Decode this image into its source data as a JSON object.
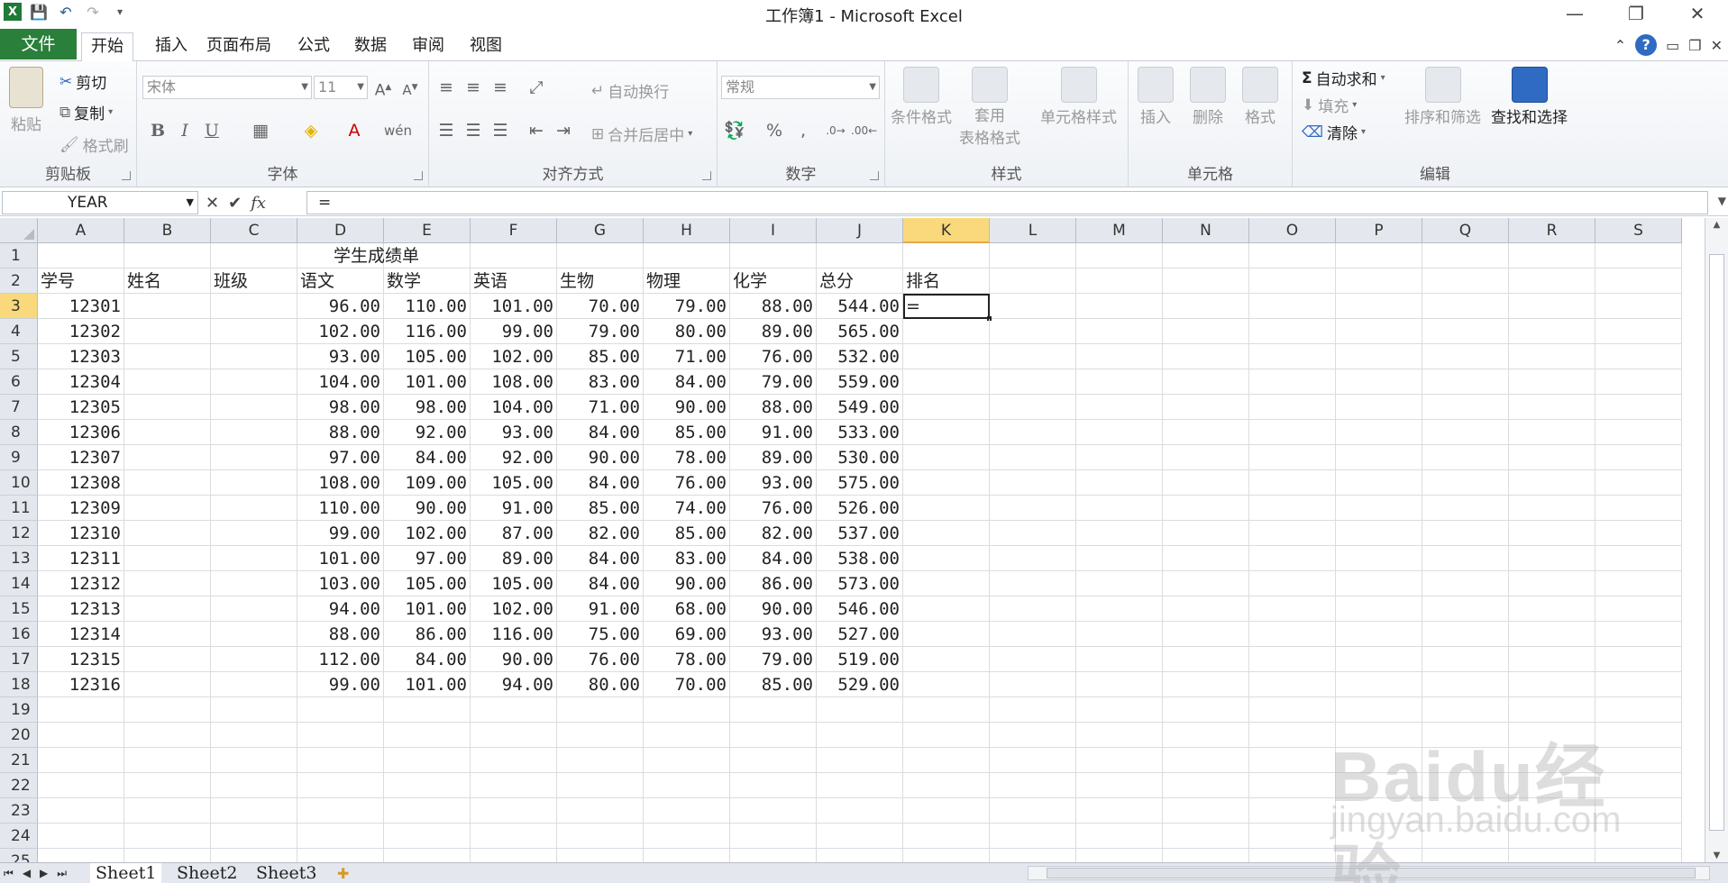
{
  "window": {
    "title": "工作簿1 - Microsoft Excel",
    "controls": [
      "—",
      "❐",
      "✕"
    ]
  },
  "tabs": {
    "file": "文件",
    "items": [
      "开始",
      "插入",
      "页面布局",
      "公式",
      "数据",
      "审阅",
      "视图"
    ]
  },
  "ribbon": {
    "clipboard": {
      "label": "剪贴板",
      "paste": "粘贴",
      "cut": "剪切",
      "copy": "复制",
      "format_painter": "格式刷"
    },
    "font": {
      "label": "字体",
      "font_name": "宋体",
      "font_size": "11",
      "bold": "B",
      "italic": "I",
      "underline": "U"
    },
    "alignment": {
      "label": "对齐方式",
      "wrap": "自动换行",
      "merge": "合并后居中"
    },
    "number": {
      "label": "数字",
      "format": "常规",
      "percent": "%",
      "comma": ","
    },
    "styles": {
      "label": "样式",
      "conditional": "条件格式",
      "table_line1": "套用",
      "table_line2": "表格格式",
      "cell_styles": "单元格样式"
    },
    "cells": {
      "label": "单元格",
      "insert": "插入",
      "delete": "删除",
      "format": "格式"
    },
    "editing": {
      "label": "编辑",
      "autosum": "自动求和",
      "fill": "填充",
      "clear": "清除",
      "sort": "排序和筛选",
      "find": "查找和选择"
    }
  },
  "formula_bar": {
    "name_box": "YEAR",
    "formula": "="
  },
  "grid": {
    "columns": [
      "A",
      "B",
      "C",
      "D",
      "E",
      "F",
      "G",
      "H",
      "I",
      "J",
      "K",
      "L",
      "M",
      "N",
      "O",
      "P",
      "Q",
      "R",
      "S"
    ],
    "selected_column": "K",
    "selected_row": 3,
    "title": "学生成绩单",
    "headers": [
      "学号",
      "姓名",
      "班级",
      "语文",
      "数学",
      "英语",
      "生物",
      "物理",
      "化学",
      "总分",
      "排名"
    ],
    "active_cell_text": "=",
    "rows": [
      [
        "12301",
        "96.00",
        "110.00",
        "101.00",
        "70.00",
        "79.00",
        "88.00",
        "544.00"
      ],
      [
        "12302",
        "102.00",
        "116.00",
        "99.00",
        "79.00",
        "80.00",
        "89.00",
        "565.00"
      ],
      [
        "12303",
        "93.00",
        "105.00",
        "102.00",
        "85.00",
        "71.00",
        "76.00",
        "532.00"
      ],
      [
        "12304",
        "104.00",
        "101.00",
        "108.00",
        "83.00",
        "84.00",
        "79.00",
        "559.00"
      ],
      [
        "12305",
        "98.00",
        "98.00",
        "104.00",
        "71.00",
        "90.00",
        "88.00",
        "549.00"
      ],
      [
        "12306",
        "88.00",
        "92.00",
        "93.00",
        "84.00",
        "85.00",
        "91.00",
        "533.00"
      ],
      [
        "12307",
        "97.00",
        "84.00",
        "92.00",
        "90.00",
        "78.00",
        "89.00",
        "530.00"
      ],
      [
        "12308",
        "108.00",
        "109.00",
        "105.00",
        "84.00",
        "76.00",
        "93.00",
        "575.00"
      ],
      [
        "12309",
        "110.00",
        "90.00",
        "91.00",
        "85.00",
        "74.00",
        "76.00",
        "526.00"
      ],
      [
        "12310",
        "99.00",
        "102.00",
        "87.00",
        "82.00",
        "85.00",
        "82.00",
        "537.00"
      ],
      [
        "12311",
        "101.00",
        "97.00",
        "89.00",
        "84.00",
        "83.00",
        "84.00",
        "538.00"
      ],
      [
        "12312",
        "103.00",
        "105.00",
        "105.00",
        "84.00",
        "90.00",
        "86.00",
        "573.00"
      ],
      [
        "12313",
        "94.00",
        "101.00",
        "102.00",
        "91.00",
        "68.00",
        "90.00",
        "546.00"
      ],
      [
        "12314",
        "88.00",
        "86.00",
        "116.00",
        "75.00",
        "69.00",
        "93.00",
        "527.00"
      ],
      [
        "12315",
        "112.00",
        "84.00",
        "90.00",
        "76.00",
        "78.00",
        "79.00",
        "519.00"
      ],
      [
        "12316",
        "99.00",
        "101.00",
        "94.00",
        "80.00",
        "70.00",
        "85.00",
        "529.00"
      ]
    ],
    "total_rows": 25
  },
  "sheets": [
    "Sheet1",
    "Sheet2",
    "Sheet3"
  ],
  "watermark": {
    "logo": "Baidu经验",
    "sub": "jingyan.baidu.com"
  },
  "colors": {
    "file_tab": "#2a7f3a",
    "selected_header": "#f9d97c"
  }
}
